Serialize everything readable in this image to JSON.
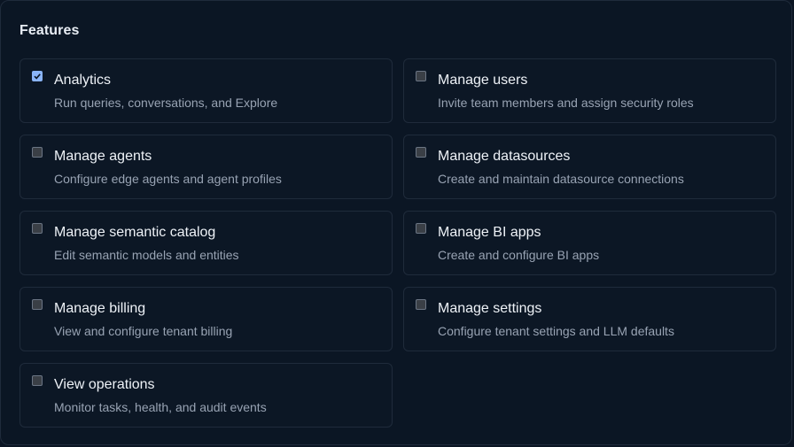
{
  "panel": {
    "title": "Features"
  },
  "features": [
    {
      "title": "Analytics",
      "description": "Run queries, conversations, and Explore",
      "checked": true
    },
    {
      "title": "Manage users",
      "description": "Invite team members and assign security roles",
      "checked": false
    },
    {
      "title": "Manage agents",
      "description": "Configure edge agents and agent profiles",
      "checked": false
    },
    {
      "title": "Manage datasources",
      "description": "Create and maintain datasource connections",
      "checked": false
    },
    {
      "title": "Manage semantic catalog",
      "description": "Edit semantic models and entities",
      "checked": false
    },
    {
      "title": "Manage BI apps",
      "description": "Create and configure BI apps",
      "checked": false
    },
    {
      "title": "Manage billing",
      "description": "View and configure tenant billing",
      "checked": false
    },
    {
      "title": "Manage settings",
      "description": "Configure tenant settings and LLM defaults",
      "checked": false
    },
    {
      "title": "View operations",
      "description": "Monitor tasks, health, and audit events",
      "checked": false
    }
  ],
  "colors": {
    "background": "#0b1624",
    "border": "#1f2b3b",
    "checked_accent": "#8ab4f8",
    "title_text": "#eef2f7",
    "description_text": "#98a3b3"
  }
}
